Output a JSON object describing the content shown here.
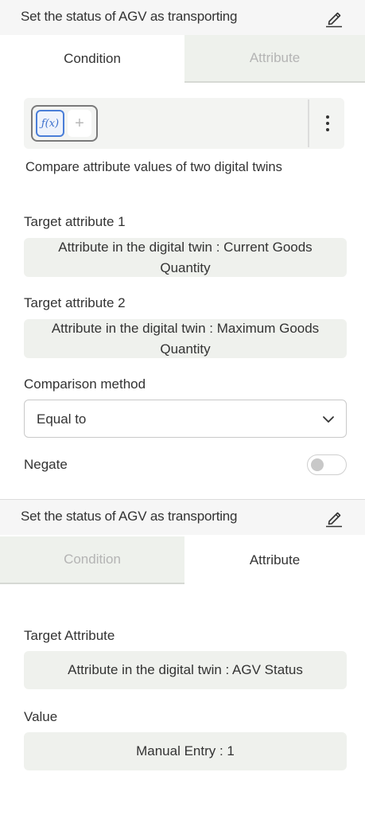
{
  "panel_top": {
    "title": "Set the status of AGV as transporting",
    "tabs": {
      "condition": "Condition",
      "attribute": "Attribute",
      "active": "Condition"
    },
    "toolbar": {
      "fx_label": "ƒ(x)",
      "plus_label": "+"
    },
    "description": "Compare attribute values of two digital twins",
    "target1": {
      "label": "Target attribute 1",
      "value": "Attribute in the digital twin : Current Goods Quantity"
    },
    "target2": {
      "label": "Target attribute 2",
      "value": "Attribute in the digital twin : Maximum Goods Quantity"
    },
    "comparison": {
      "label": "Comparison method",
      "selected": "Equal to"
    },
    "negate": {
      "label": "Negate",
      "on": false
    }
  },
  "panel_bottom": {
    "title": "Set the status of AGV as transporting",
    "tabs": {
      "condition": "Condition",
      "attribute": "Attribute",
      "active": "Attribute"
    },
    "target": {
      "label": "Target Attribute",
      "value": "Attribute in the digital twin : AGV Status"
    },
    "value": {
      "label": "Value",
      "value": "Manual Entry : 1"
    }
  },
  "colors": {
    "header_bg": "#f6f6f6",
    "inactive_tab_bg": "#eef1ec",
    "field_bg": "#eff1ed",
    "accent": "#4a7ed8"
  },
  "icons": [
    "edit-pencil-icon",
    "function-icon",
    "plus-icon",
    "more-vertical-icon",
    "chevron-down-icon"
  ]
}
